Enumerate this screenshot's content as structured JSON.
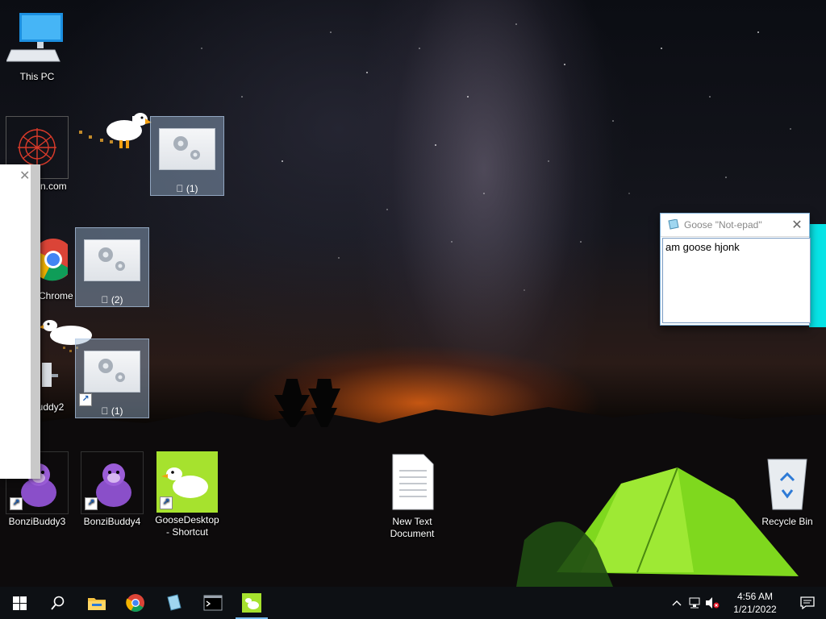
{
  "desktop": {
    "icons": {
      "this_pc": "This PC",
      "partial_com": "on.com",
      "settings_1a": "\u0000 (1)",
      "chrome": "Chrome",
      "settings_2": "\u0000 (2)",
      "buddy2": "uddy2",
      "settings_1b": "\u0000 (1)",
      "bonzi3": "BonziBuddy3",
      "bonzi4": "BonziBuddy4",
      "goose_shortcut": "GooseDesktop - Shortcut",
      "new_text_doc": "New Text Document",
      "recycle_bin": "Recycle Bin"
    }
  },
  "notepad": {
    "title": "Goose \"Not-epad\"",
    "text": "am goose hjonk"
  },
  "left_window": {
    "close_glyph": "✕"
  },
  "taskbar": {
    "clock_time": "4:56 AM",
    "clock_date": "1/21/2022"
  },
  "colors": {
    "accent": "#76b9ed",
    "selection": "#99b4d1",
    "cyan": "#08e3e6",
    "goose_bg": "#a6e22e"
  }
}
